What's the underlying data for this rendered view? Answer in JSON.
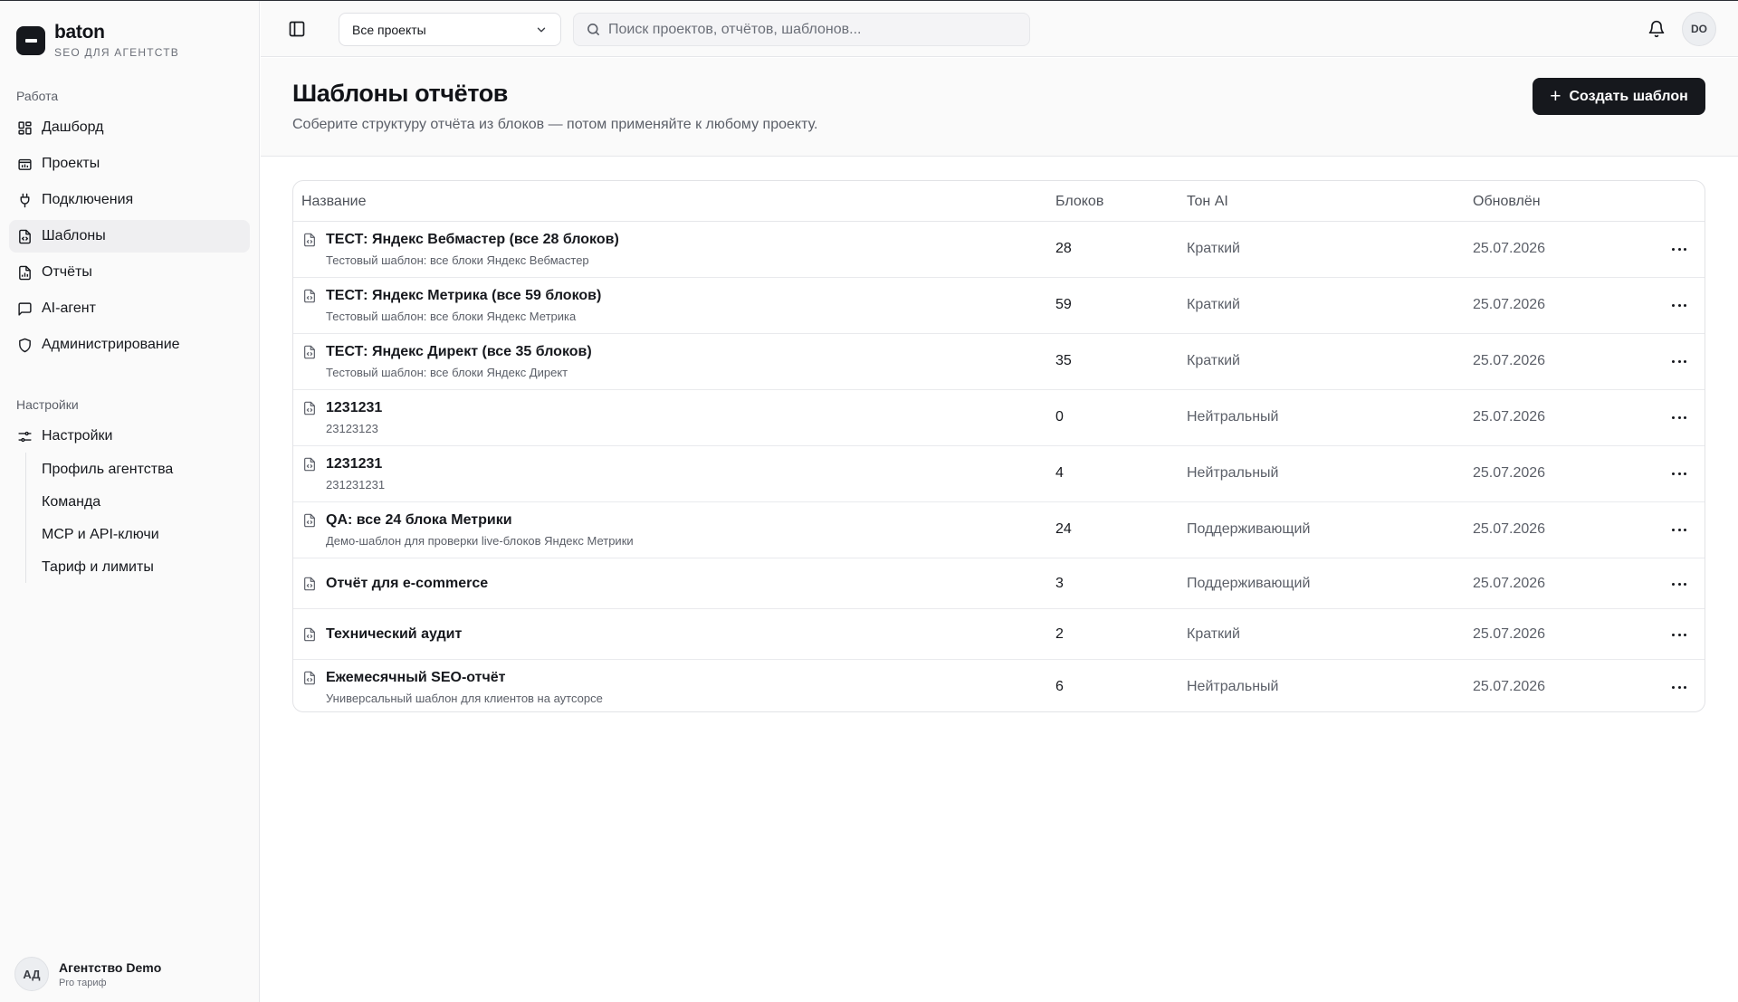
{
  "brand": {
    "name": "baton",
    "subtitle": "SEO ДЛЯ АГЕНТСТВ"
  },
  "sidebar": {
    "work_label": "Работа",
    "items": [
      {
        "label": "Дашборд",
        "icon": "dashboard-icon"
      },
      {
        "label": "Проекты",
        "icon": "projects-icon"
      },
      {
        "label": "Подключения",
        "icon": "plug-icon"
      },
      {
        "label": "Шаблоны",
        "icon": "template-icon",
        "active": true
      },
      {
        "label": "Отчёты",
        "icon": "report-icon"
      },
      {
        "label": "AI-агент",
        "icon": "chat-icon"
      },
      {
        "label": "Администрирование",
        "icon": "shield-icon"
      }
    ],
    "settings_label": "Настройки",
    "settings_item": "Настройки",
    "settings_subitems": [
      "Профиль агентства",
      "Команда",
      "MCP и API-ключи",
      "Тариф и лимиты"
    ],
    "account": {
      "initials": "АД",
      "name": "Агентство Demo",
      "plan": "Pro тариф"
    }
  },
  "topbar": {
    "project_select": "Все проекты",
    "search_placeholder": "Поиск проектов, отчётов, шаблонов...",
    "user_initials": "DO"
  },
  "page": {
    "title": "Шаблоны отчётов",
    "description": "Соберите структуру отчёта из блоков — потом применяйте к любому проекту.",
    "create_button": "Создать шаблон"
  },
  "table": {
    "columns": [
      "Название",
      "Блоков",
      "Тон AI",
      "Обновлён"
    ],
    "rows": [
      {
        "name": "ТЕСТ: Яндекс Вебмастер (все 28 блоков)",
        "desc": "Тестовый шаблон: все блоки Яндекс Вебмастер",
        "blocks": "28",
        "tone": "Краткий",
        "updated": "25.07.2026"
      },
      {
        "name": "ТЕСТ: Яндекс Метрика (все 59 блоков)",
        "desc": "Тестовый шаблон: все блоки Яндекс Метрика",
        "blocks": "59",
        "tone": "Краткий",
        "updated": "25.07.2026"
      },
      {
        "name": "ТЕСТ: Яндекс Директ (все 35 блоков)",
        "desc": "Тестовый шаблон: все блоки Яндекс Директ",
        "blocks": "35",
        "tone": "Краткий",
        "updated": "25.07.2026"
      },
      {
        "name": "1231231",
        "desc": "23123123",
        "blocks": "0",
        "tone": "Нейтральный",
        "updated": "25.07.2026"
      },
      {
        "name": "1231231",
        "desc": "231231231",
        "blocks": "4",
        "tone": "Нейтральный",
        "updated": "25.07.2026"
      },
      {
        "name": "QA: все 24 блока Метрики",
        "desc": "Демо-шаблон для проверки live-блоков Яндекс Метрики",
        "blocks": "24",
        "tone": "Поддерживающий",
        "updated": "25.07.2026"
      },
      {
        "name": "Отчёт для e-commerce",
        "desc": "",
        "blocks": "3",
        "tone": "Поддерживающий",
        "updated": "25.07.2026"
      },
      {
        "name": "Технический аудит",
        "desc": "",
        "blocks": "2",
        "tone": "Краткий",
        "updated": "25.07.2026"
      },
      {
        "name": "Ежемесячный SEO-отчёт",
        "desc": "Универсальный шаблон для клиентов на аутсорсе",
        "blocks": "6",
        "tone": "Нейтральный",
        "updated": "25.07.2026"
      }
    ]
  }
}
